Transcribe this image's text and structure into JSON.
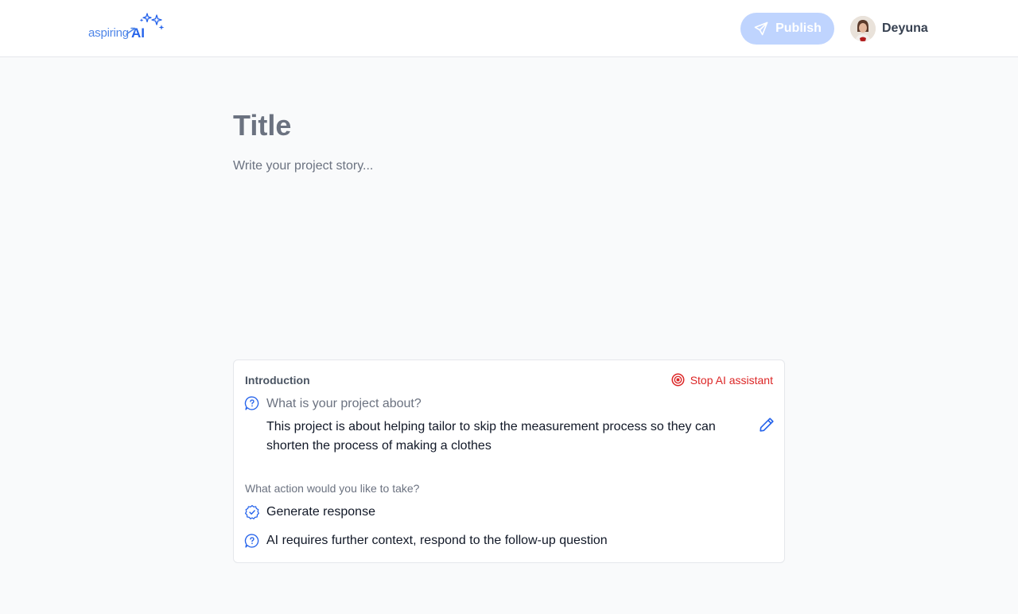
{
  "header": {
    "logo": {
      "word": "aspiring",
      "ai": "AI",
      "icon": "sparkles-icon"
    },
    "publish_label": "Publish",
    "publish_icon": "send-icon",
    "user": {
      "name": "Deyuna",
      "avatar": "avatar"
    }
  },
  "editor": {
    "title_placeholder": "Title",
    "story_placeholder": "Write your project story..."
  },
  "assistant": {
    "section": "Introduction",
    "stop_label": "Stop AI assistant",
    "question": "What is your project about?",
    "answer": "This project is about helping tailor to skip the measurement process so they can shorten the process of making a clothes",
    "action_prompt": "What action would you like to take?",
    "actions": [
      {
        "label": "Generate response",
        "icon": "verified-badge-icon"
      },
      {
        "label": "AI requires further context, respond to the follow-up question",
        "icon": "question-bubble-icon"
      }
    ]
  },
  "colors": {
    "accent": "#2563eb",
    "publish_disabled": "#bfd4fe",
    "stop": "#dc2626",
    "background": "#f9fafb"
  }
}
